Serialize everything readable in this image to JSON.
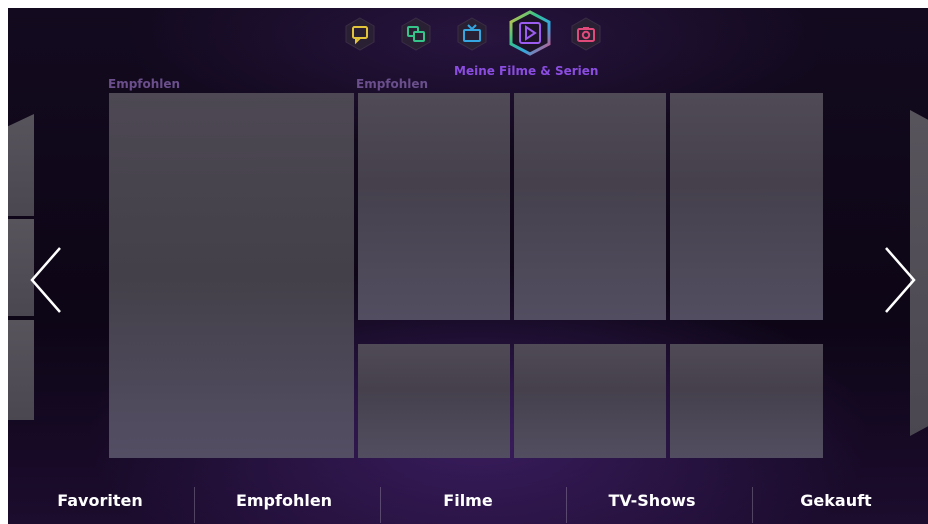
{
  "hub": {
    "icons": [
      {
        "name": "chat-icon",
        "color": "#e2c43a"
      },
      {
        "name": "multiscreen-icon",
        "color": "#35c48a"
      },
      {
        "name": "tv-icon",
        "color": "#35a6e0"
      },
      {
        "name": "play-icon",
        "color": "#8a4de0",
        "selected": true
      },
      {
        "name": "camera-icon",
        "color": "#e04a7a"
      }
    ],
    "selected_label": "Meine Filme & Serien"
  },
  "sections": [
    {
      "label": "Empfohlen"
    },
    {
      "label": "Empfohlen"
    }
  ],
  "bottom_nav": [
    {
      "label": "Favoriten"
    },
    {
      "label": "Empfohlen"
    },
    {
      "label": "Filme"
    },
    {
      "label": "TV-Shows"
    },
    {
      "label": "Gekauft"
    }
  ],
  "colors": {
    "background": "#0d0616",
    "accent": "#8a4de0",
    "tile": "#4a4550"
  }
}
